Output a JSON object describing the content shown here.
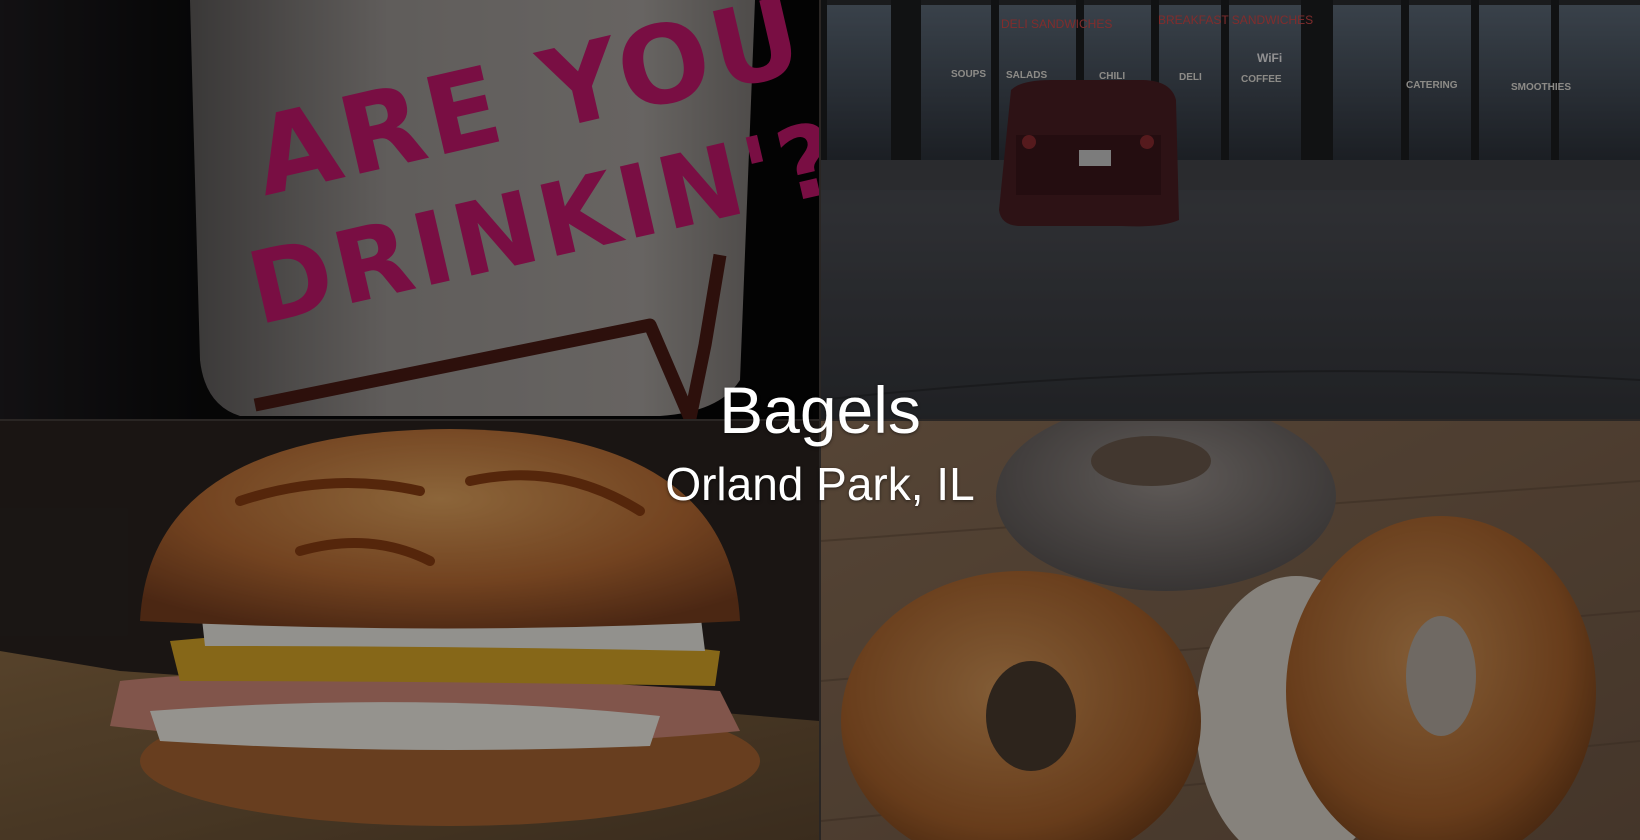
{
  "hero": {
    "title": "Bagels",
    "location": "Orland Park, IL"
  },
  "photos": {
    "cup": {
      "slogan_line_1": "ARE YOU",
      "slogan_line_2": "DRINKIN'?"
    },
    "storefront": {
      "window_sign_1": "DELI SANDWICHES",
      "window_sign_2": "BREAKFAST SANDWICHES",
      "wifi_sign": "WiFi",
      "awning_labels": [
        "SOUPS",
        "SALADS",
        "CHILI",
        "DELI",
        "COFFEE",
        "CATERING",
        "SMOOTHIES"
      ]
    }
  },
  "colors": {
    "cup_text": "#c4176c",
    "overlay": "rgba(0,0,0,0.38)",
    "caption_text": "#ffffff"
  }
}
